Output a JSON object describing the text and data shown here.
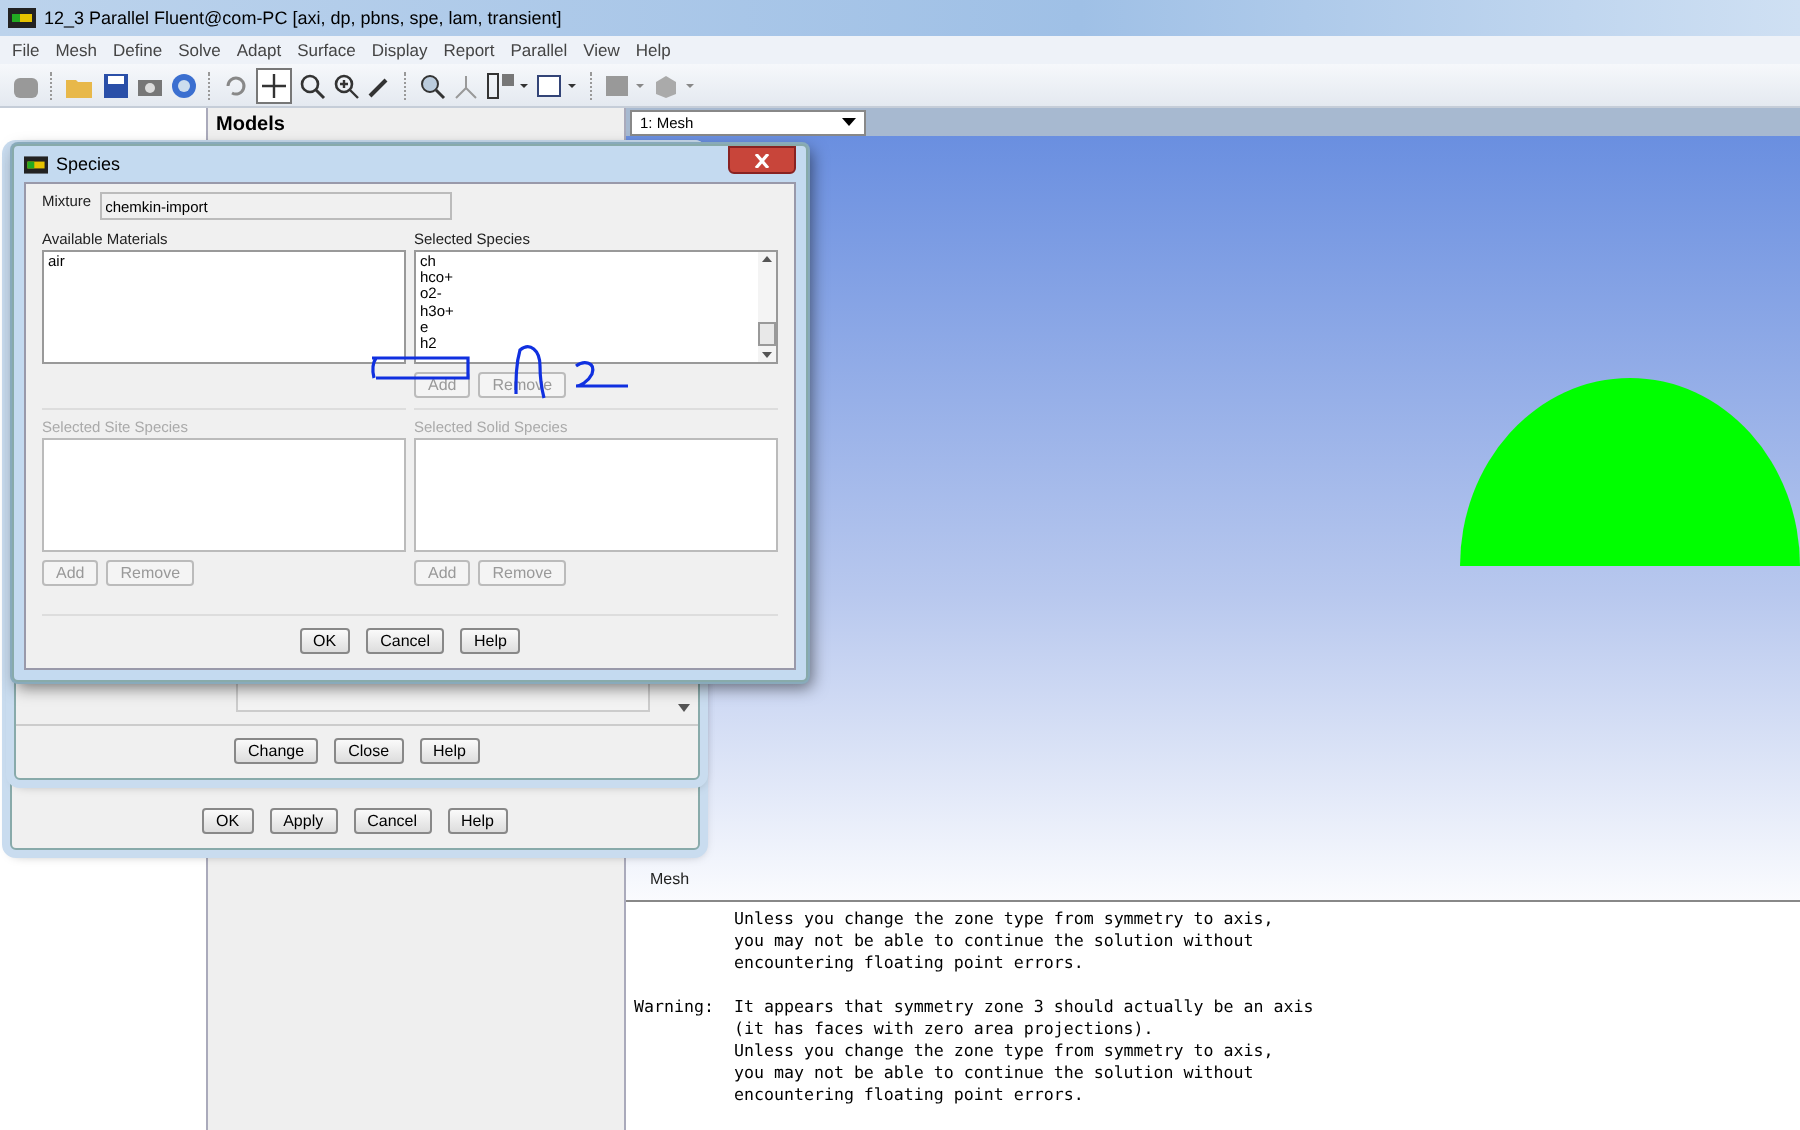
{
  "window": {
    "title": "12_3 Parallel Fluent@com-PC  [axi, dp, pbns, spe, lam, transient]"
  },
  "menu": [
    "File",
    "Mesh",
    "Define",
    "Solve",
    "Adapt",
    "Surface",
    "Display",
    "Report",
    "Parallel",
    "View",
    "Help"
  ],
  "task_page": {
    "title": "Models"
  },
  "graphics": {
    "window_select": "1: Mesh",
    "label": "Mesh"
  },
  "console": [
    {
      "lines": [
        "Unless you change the zone type from symmetry to axis,",
        "you may not be able to continue the solution without",
        "encountering floating point errors."
      ]
    },
    {
      "label": "Warning:",
      "lines": [
        "It appears that symmetry zone 3 should actually be an axis",
        "(it has faces with zero area projections).",
        "Unless you change the zone type from symmetry to axis,",
        "you may not be able to continue the solution without",
        "encountering floating point errors."
      ]
    }
  ],
  "back_dialogs": [
    {
      "buttons": [
        "Change",
        "Close",
        "Help"
      ]
    },
    {
      "buttons": [
        "OK",
        "Apply",
        "Cancel",
        "Help"
      ]
    }
  ],
  "species_dialog": {
    "title": "Species",
    "mixture_label": "Mixture",
    "mixture": "chemkin-import",
    "lists": [
      {
        "title": "Available Materials",
        "disabled": false,
        "items": [
          "air"
        ]
      },
      {
        "title": "Selected Species",
        "disabled": false,
        "items": [
          "ch",
          "hco+",
          "o2-",
          "h3o+",
          "e",
          "h2"
        ],
        "buttons": [
          {
            "label": "Add",
            "disabled": true
          },
          {
            "label": "Remove",
            "disabled": true
          }
        ]
      },
      {
        "title": "Selected Site Species",
        "disabled": true,
        "buttons": [
          {
            "label": "Add",
            "disabled": true
          },
          {
            "label": "Remove",
            "disabled": true
          }
        ]
      },
      {
        "title": "Selected Solid Species",
        "disabled": true,
        "buttons": [
          {
            "label": "Add",
            "disabled": true
          },
          {
            "label": "Remove",
            "disabled": true
          }
        ]
      }
    ],
    "buttons": [
      "OK",
      "Cancel",
      "Help"
    ]
  }
}
